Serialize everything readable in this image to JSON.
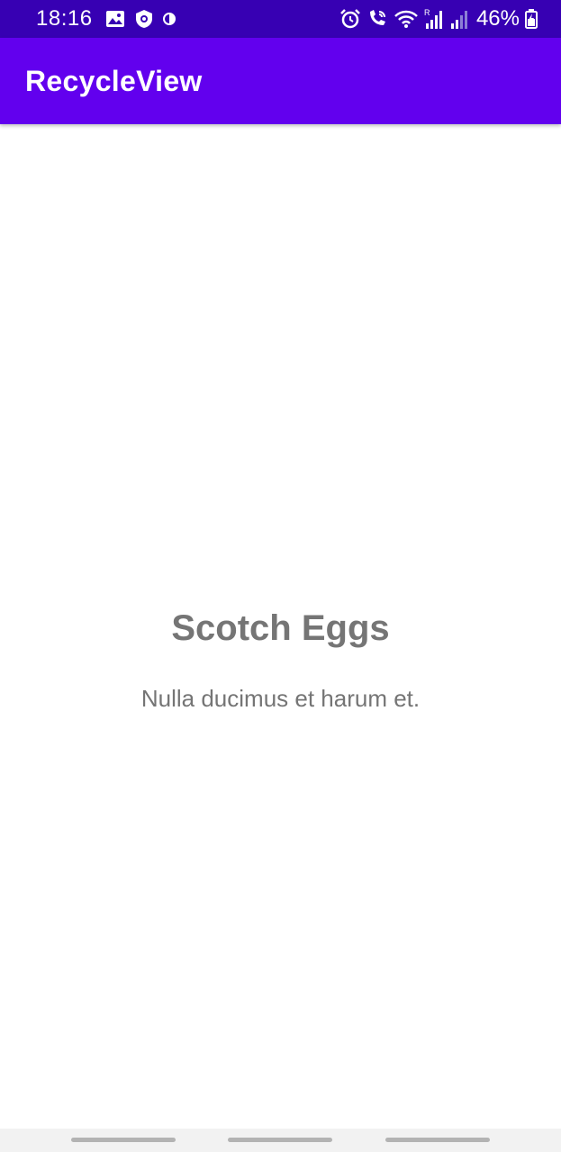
{
  "status_bar": {
    "time": "18:16",
    "battery_percent": "46%",
    "icons": [
      "gallery-icon",
      "shield-icon",
      "data-saver-icon",
      "alarm-icon",
      "wifi-call-icon",
      "wifi-icon",
      "signal-roaming-icon",
      "signal-icon",
      "battery-icon"
    ]
  },
  "app_bar": {
    "title": "RecycleView"
  },
  "item": {
    "title": "Scotch Eggs",
    "description": "Nulla ducimus et harum et."
  },
  "colors": {
    "status_bar": "#3700b3",
    "app_bar": "#6200ee",
    "text_secondary": "#757575"
  }
}
